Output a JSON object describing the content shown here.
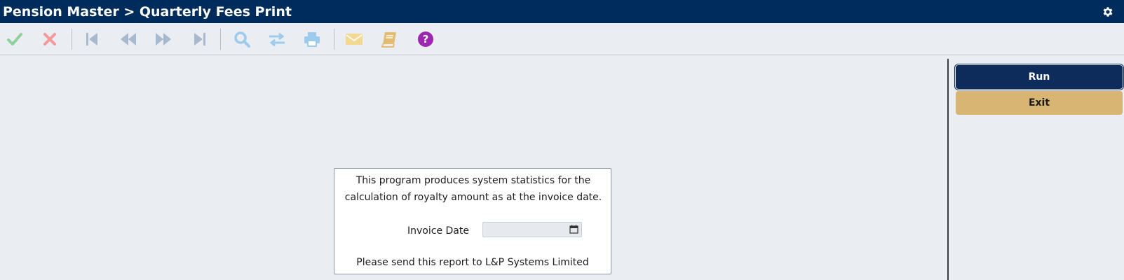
{
  "header": {
    "title": "Pension Master > Quarterly Fees Print",
    "settings_icon": "gear-icon"
  },
  "toolbar": {
    "items": [
      {
        "name": "accept",
        "icon": "check-icon",
        "color": "#8ed19a"
      },
      {
        "name": "cancel",
        "icon": "close-icon",
        "color": "#f29a9a"
      },
      {
        "name": "first",
        "icon": "first-record-icon",
        "color": "#a7b9cf"
      },
      {
        "name": "previous",
        "icon": "previous-record-icon",
        "color": "#a7b9cf"
      },
      {
        "name": "next",
        "icon": "next-record-icon",
        "color": "#a7b9cf"
      },
      {
        "name": "last",
        "icon": "last-record-icon",
        "color": "#a7b9cf"
      },
      {
        "name": "search",
        "icon": "search-icon",
        "color": "#9ccbee"
      },
      {
        "name": "swap",
        "icon": "swap-icon",
        "color": "#9ccbee"
      },
      {
        "name": "print",
        "icon": "print-icon",
        "color": "#9ccbee"
      },
      {
        "name": "email",
        "icon": "mail-icon",
        "color": "#f3d88f"
      },
      {
        "name": "notes",
        "icon": "book-icon",
        "color": "#e5bb6f"
      },
      {
        "name": "help",
        "icon": "help-icon",
        "color": "#9c27b0"
      }
    ]
  },
  "actions": {
    "run_label": "Run",
    "exit_label": "Exit"
  },
  "form": {
    "description": "This program produces system statistics for the calculation of royalty amount as at the invoice date.",
    "invoice_date_label": "Invoice Date",
    "invoice_date_value": "",
    "note": "Please send this report to L&P Systems Limited"
  },
  "colors": {
    "header_bg": "#002c5b",
    "run_bg": "#0d2c5c",
    "exit_bg": "#d9b574",
    "page_bg": "#eaedf1"
  }
}
